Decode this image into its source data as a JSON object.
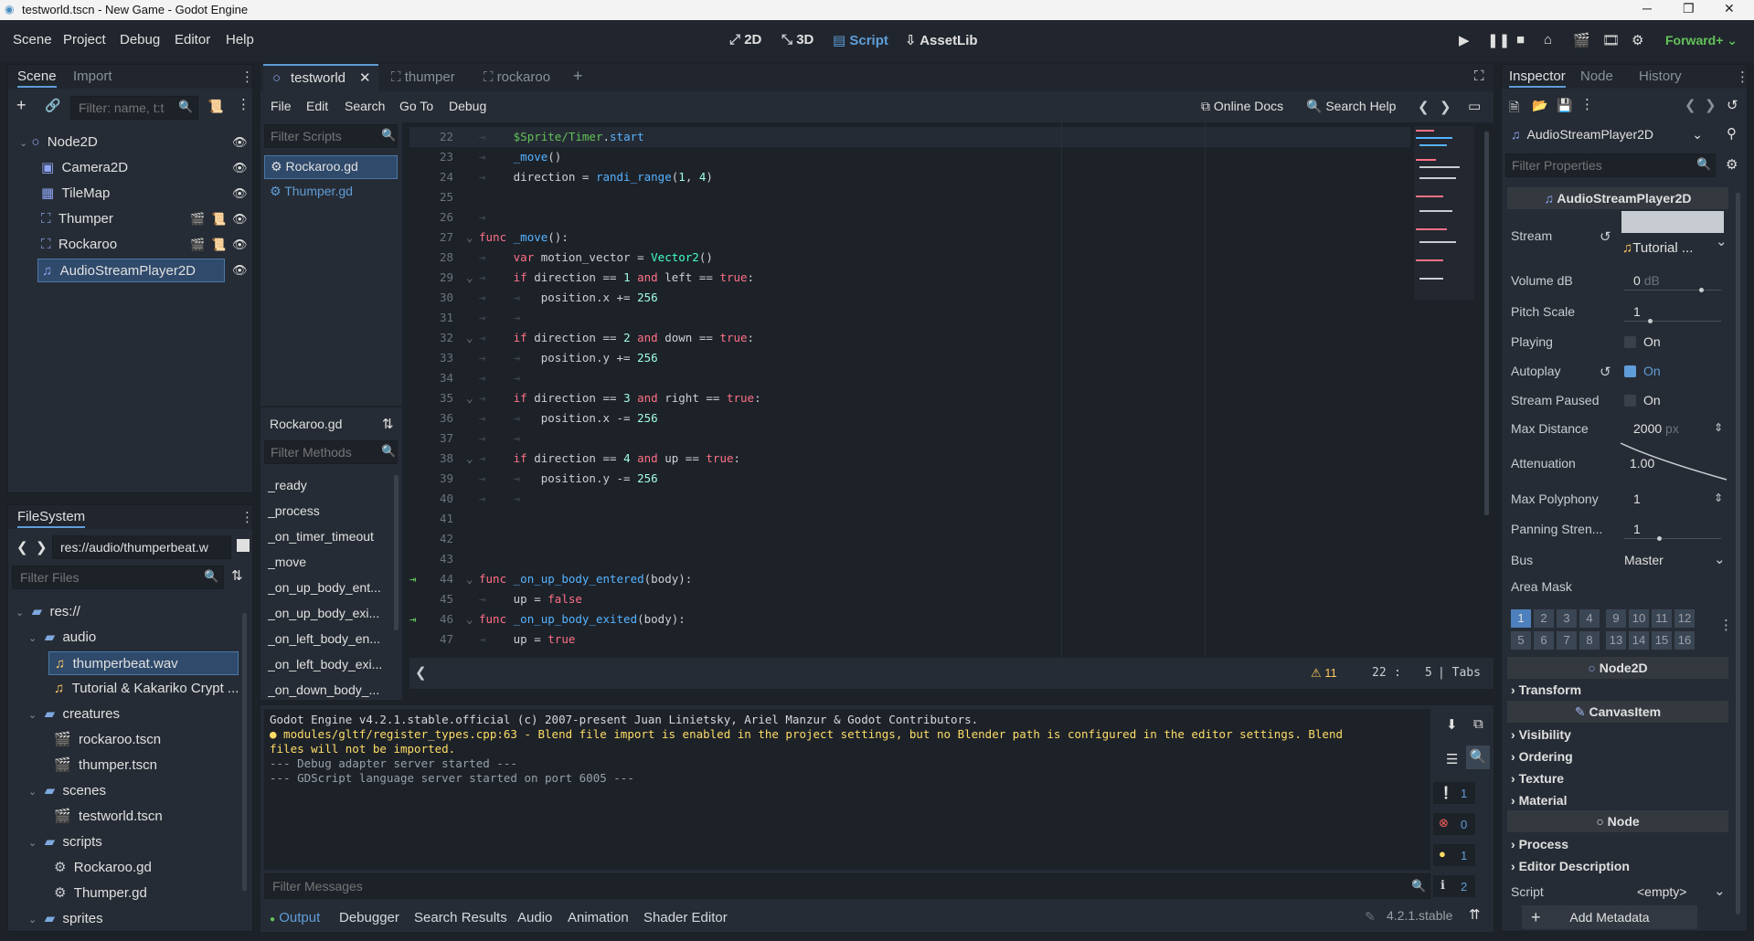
{
  "window": {
    "title": "testworld.tscn - New Game - Godot Engine"
  },
  "menubar": {
    "items": [
      "Scene",
      "Project",
      "Debug",
      "Editor",
      "Help"
    ],
    "modes": [
      "2D",
      "3D",
      "Script",
      "AssetLib"
    ],
    "renderer": "Forward+"
  },
  "scene_dock": {
    "tabs": [
      "Scene",
      "Import"
    ],
    "filter_placeholder": "Filter: name, t:t",
    "nodes": [
      {
        "label": "Node2D",
        "icon": "node2d-icon"
      },
      {
        "label": "Camera2D",
        "icon": "camera2d-icon"
      },
      {
        "label": "TileMap",
        "icon": "tilemap-icon"
      },
      {
        "label": "Thumper",
        "icon": "scene-instance-icon"
      },
      {
        "label": "Rockaroo",
        "icon": "scene-instance-icon"
      },
      {
        "label": "AudioStreamPlayer2D",
        "icon": "audio-stream-icon"
      }
    ]
  },
  "filesystem": {
    "tab": "FileSystem",
    "path": "res://audio/thumperbeat.w",
    "filter_placeholder": "Filter Files",
    "items": [
      {
        "label": "res://",
        "type": "folder"
      },
      {
        "label": "audio",
        "type": "folder"
      },
      {
        "label": "thumperbeat.wav",
        "type": "audio"
      },
      {
        "label": "Tutorial & Kakariko Crypt ...",
        "type": "audio"
      },
      {
        "label": "creatures",
        "type": "folder"
      },
      {
        "label": "rockaroo.tscn",
        "type": "scene"
      },
      {
        "label": "thumper.tscn",
        "type": "scene"
      },
      {
        "label": "scenes",
        "type": "folder"
      },
      {
        "label": "testworld.tscn",
        "type": "scene"
      },
      {
        "label": "scripts",
        "type": "folder"
      },
      {
        "label": "Rockaroo.gd",
        "type": "script"
      },
      {
        "label": "Thumper.gd",
        "type": "script"
      },
      {
        "label": "sprites",
        "type": "folder"
      }
    ]
  },
  "editor_tabs": [
    "testworld",
    "thumper",
    "rockaroo"
  ],
  "script_menu": {
    "items": [
      "File",
      "Edit",
      "Search",
      "Go To",
      "Debug"
    ],
    "online_docs": "Online Docs",
    "search_help": "Search Help"
  },
  "scripts_panel": {
    "filter_placeholder": "Filter Scripts",
    "scripts": [
      "Rockaroo.gd",
      "Thumper.gd"
    ],
    "current": "Rockaroo.gd",
    "methods_placeholder": "Filter Methods",
    "methods": [
      "_ready",
      "_process",
      "_on_timer_timeout",
      "_move",
      "_on_up_body_ent...",
      "_on_up_body_exi...",
      "_on_left_body_en...",
      "_on_left_body_exi...",
      "_on_down_body_..."
    ]
  },
  "code": {
    "lines": [
      {
        "n": "22",
        "html": "<span class=\"tab-guide\">⇥</span>    <span class=\"path\">$Sprite/Timer</span>.<span class=\"fn\">start</span>"
      },
      {
        "n": "23",
        "html": "<span class=\"tab-guide\">⇥</span>    <span class=\"fn\">_move</span>()"
      },
      {
        "n": "24",
        "html": "<span class=\"tab-guide\">⇥</span>    direction = <span class=\"fn\">randi_range</span>(<span class=\"num\">1</span>, <span class=\"num\">4</span>)"
      },
      {
        "n": "25",
        "html": ""
      },
      {
        "n": "26",
        "html": "<span class=\"tab-guide\">⇥</span>"
      },
      {
        "n": "27",
        "html": "<span class=\"kw\">func</span> <span class=\"fn\">_move</span>():"
      },
      {
        "n": "28",
        "html": "<span class=\"tab-guide\">⇥</span>    <span class=\"kw\">var</span> motion_vector = <span class=\"ty\">Vector2</span>()"
      },
      {
        "n": "29",
        "html": "<span class=\"tab-guide\">⇥</span>    <span class=\"kw\">if</span> direction == <span class=\"num\">1</span> <span class=\"kw\">and</span> left == <span class=\"kw\">true</span>:"
      },
      {
        "n": "30",
        "html": "<span class=\"tab-guide\">⇥</span>    <span class=\"tab-guide\">⇥</span>   position.x += <span class=\"num\">256</span>"
      },
      {
        "n": "31",
        "html": "<span class=\"tab-guide\">⇥</span>    <span class=\"tab-guide\">⇥</span>"
      },
      {
        "n": "32",
        "html": "<span class=\"tab-guide\">⇥</span>    <span class=\"kw\">if</span> direction == <span class=\"num\">2</span> <span class=\"kw\">and</span> down == <span class=\"kw\">true</span>:"
      },
      {
        "n": "33",
        "html": "<span class=\"tab-guide\">⇥</span>    <span class=\"tab-guide\">⇥</span>   position.y += <span class=\"num\">256</span>"
      },
      {
        "n": "34",
        "html": "<span class=\"tab-guide\">⇥</span>    <span class=\"tab-guide\">⇥</span>"
      },
      {
        "n": "35",
        "html": "<span class=\"tab-guide\">⇥</span>    <span class=\"kw\">if</span> direction == <span class=\"num\">3</span> <span class=\"kw\">and</span> right == <span class=\"kw\">true</span>:"
      },
      {
        "n": "36",
        "html": "<span class=\"tab-guide\">⇥</span>    <span class=\"tab-guide\">⇥</span>   position.x -= <span class=\"num\">256</span>"
      },
      {
        "n": "37",
        "html": "<span class=\"tab-guide\">⇥</span>    <span class=\"tab-guide\">⇥</span>"
      },
      {
        "n": "38",
        "html": "<span class=\"tab-guide\">⇥</span>    <span class=\"kw\">if</span> direction == <span class=\"num\">4</span> <span class=\"kw\">and</span> up == <span class=\"kw\">true</span>:"
      },
      {
        "n": "39",
        "html": "<span class=\"tab-guide\">⇥</span>    <span class=\"tab-guide\">⇥</span>   position.y -= <span class=\"num\">256</span>"
      },
      {
        "n": "40",
        "html": "<span class=\"tab-guide\">⇥</span>    <span class=\"tab-guide\">⇥</span>"
      },
      {
        "n": "41",
        "html": ""
      },
      {
        "n": "42",
        "html": ""
      },
      {
        "n": "43",
        "html": ""
      },
      {
        "n": "44",
        "html": "<span class=\"kw\">func</span> <span class=\"fn\">_on_up_body_entered</span>(body):"
      },
      {
        "n": "45",
        "html": "<span class=\"tab-guide\">⇥</span>    up = <span class=\"kw\">false</span>"
      },
      {
        "n": "46",
        "html": "<span class=\"kw\">func</span> <span class=\"fn\">_on_up_body_exited</span>(body):"
      },
      {
        "n": "47",
        "html": "<span class=\"tab-guide\">⇥</span>    up = <span class=\"kw\">true</span>"
      }
    ],
    "warnings": "11",
    "line": "22",
    "col": "5",
    "indent": "Tabs"
  },
  "output": {
    "lines": [
      {
        "text": "Godot Engine v4.2.1.stable.official (c) 2007-present Juan Linietsky, Ariel Manzur & Godot Contributors.",
        "color": "#d6d9de"
      },
      {
        "text": "● modules/gltf/register_types.cpp:63 - Blend file import is enabled in the project settings, but no Blender path is configured in the editor settings. Blend",
        "color": "#ffdd65"
      },
      {
        "text": "files will not be imported.",
        "color": "#ffdd65"
      },
      {
        "text": "--- Debug adapter server started ---",
        "color": "#9aa0a8"
      },
      {
        "text": "--- GDScript language server started on port 6005 ---",
        "color": "#9aa0a8"
      }
    ],
    "filter_placeholder": "Filter Messages",
    "counts": {
      "messages": "1",
      "errors": "0",
      "warnings": "1",
      "info": "2"
    }
  },
  "bottom_tabs": [
    "Output",
    "Debugger",
    "Search Results",
    "Audio",
    "Animation",
    "Shader Editor"
  ],
  "version": "4.2.1.stable",
  "inspector": {
    "tabs": [
      "Inspector",
      "Node",
      "History"
    ],
    "object": "AudioStreamPlayer2D",
    "filter_placeholder": "Filter Properties",
    "class_header": "AudioStreamPlayer2D",
    "stream_label": "Stream",
    "stream_value": "Tutorial ...",
    "props": [
      {
        "label": "Volume dB",
        "value": "0",
        "unit": "dB"
      },
      {
        "label": "Pitch Scale",
        "value": "1",
        "unit": ""
      },
      {
        "label": "Playing",
        "value": "On",
        "unit": ""
      },
      {
        "label": "Autoplay",
        "value": "On",
        "unit": ""
      },
      {
        "label": "Stream Paused",
        "value": "On",
        "unit": ""
      },
      {
        "label": "Max Distance",
        "value": "2000",
        "unit": "px"
      },
      {
        "label": "Attenuation",
        "value": "1.00",
        "unit": ""
      },
      {
        "label": "Max Polyphony",
        "value": "1",
        "unit": ""
      },
      {
        "label": "Panning Stren...",
        "value": "1",
        "unit": ""
      },
      {
        "label": "Bus",
        "value": "Master",
        "unit": ""
      },
      {
        "label": "Area Mask",
        "value": "",
        "unit": ""
      }
    ],
    "layers_row1": [
      "1",
      "2",
      "3",
      "4",
      "9",
      "10",
      "11",
      "12"
    ],
    "layers_row2": [
      "5",
      "6",
      "7",
      "8",
      "13",
      "14",
      "15",
      "16"
    ],
    "node2d_header": "Node2D",
    "transform": "Transform",
    "canvasitem_header": "CanvasItem",
    "canvas_cats": [
      "Visibility",
      "Ordering",
      "Texture",
      "Material"
    ],
    "node_header": "Node",
    "node_cats": [
      "Process",
      "Editor Description"
    ],
    "script_label": "Script",
    "script_value": "<empty>",
    "add_metadata": "Add Metadata"
  }
}
